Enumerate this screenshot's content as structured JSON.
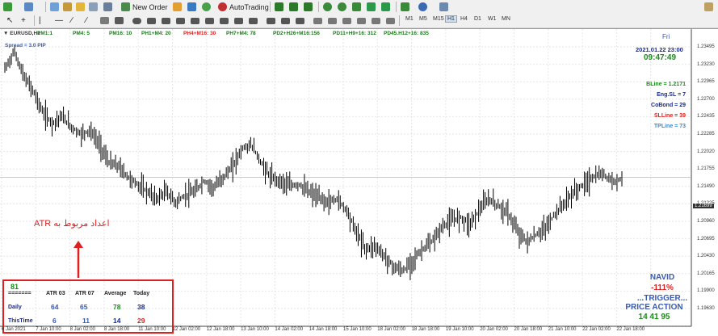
{
  "toolbar1": {
    "new_order_label": "New Order",
    "autotrading_label": "AutoTrading"
  },
  "timeframes": [
    "M1",
    "M5",
    "M15",
    "H1",
    "H4",
    "D1",
    "W1",
    "MN"
  ],
  "active_timeframe": "H1",
  "chart": {
    "symbol_label": "▼ EURUSD,H1",
    "spread_label": "Spread = 3.0  PIP",
    "header_items": [
      {
        "text": "PM1:1",
        "color": "#1a7a1a"
      },
      {
        "text": "PM4: 5",
        "color": "#1a7a1a"
      },
      {
        "text": "PM16: 10",
        "color": "#1a7a1a"
      },
      {
        "text": "PH1+M4: 20",
        "color": "#1a7a1a"
      },
      {
        "text": "PH4+M16: 30",
        "color": "#e02020"
      },
      {
        "text": "PH7+M4: 78",
        "color": "#1a7a1a"
      },
      {
        "text": "PD2+H26+M16:156",
        "color": "#1a7a1a"
      },
      {
        "text": "PD11+H9+16: 312",
        "color": "#1a7a1a"
      },
      {
        "text": "PD45.H12+16: 835",
        "color": "#1a7a1a"
      }
    ],
    "day": "Fri",
    "datetime": "2021.01.22 23:00",
    "countdown": "09:47:49",
    "indicators": [
      {
        "text": "BLine = 1.2171",
        "color": "#1a8a1a"
      },
      {
        "text": "Eng.SL = 7",
        "color": "#1a2a8a"
      },
      {
        "text": "CoBond = 29",
        "color": "#1a2a8a"
      },
      {
        "text": "SLLine = 39",
        "color": "#e02020"
      },
      {
        "text": "TPLine = 73",
        "color": "#3a8ad0"
      }
    ],
    "price_labels": [
      "1.23495",
      "1.23230",
      "1.22965",
      "1.22700",
      "1.22435",
      "1.22285",
      "1.22020",
      "1.21755",
      "1.21490",
      "1.21225",
      "1.20960",
      "1.20695",
      "1.20430",
      "1.20165",
      "1.19900",
      "1.19630"
    ],
    "current_price": "1.21699",
    "time_labels": [
      "6 Jan 2021",
      "7 Jan 10:00",
      "8 Jan 02:00",
      "8 Jan 18:00",
      "11 Jan 10:00",
      "12 Jan 02:00",
      "12 Jan 18:00",
      "13 Jan 10:00",
      "14 Jan 02:00",
      "14 Jan 18:00",
      "15 Jan 10:00",
      "18 Jan 02:00",
      "18 Jan 18:00",
      "19 Jan 10:00",
      "20 Jan 02:00",
      "20 Jan 18:00",
      "21 Jan 10:00",
      "22 Jan 02:00",
      "22 Jan 18:00"
    ],
    "annotation": "ATR اعداد مربوط به",
    "atr_table": {
      "count": "81",
      "divider": "=======",
      "headers": [
        "ATR 03",
        "ATR 07",
        "Average",
        "Today"
      ],
      "rows": [
        {
          "label": "Daily",
          "values": [
            "64",
            "65",
            "78",
            "38"
          ]
        },
        {
          "label": "ThisTime",
          "values": [
            "6",
            "11",
            "14",
            "29"
          ]
        }
      ]
    },
    "navid": {
      "name": "NAVID",
      "percent": "-111%",
      "trigger": "...TRIGGER...",
      "price_action": "PRICE ACTION",
      "numbers": "14  41  95"
    }
  },
  "chart_data": {
    "type": "ohlc",
    "symbol": "EURUSD",
    "timeframe": "H1",
    "ylim": [
      1.1963,
      1.2376
    ],
    "close_path": [
      1.232,
      1.2345,
      1.231,
      1.229,
      1.226,
      1.2245,
      1.2255,
      1.224,
      1.223,
      1.2235,
      1.2215,
      1.219,
      1.2185,
      1.217,
      1.216,
      1.215,
      1.214,
      1.215,
      1.2135,
      1.2145,
      1.215,
      1.2165,
      1.2155,
      1.217,
      1.2185,
      1.221,
      1.2215,
      1.219,
      1.217,
      1.2165,
      1.2158,
      1.216,
      1.215,
      1.2142,
      1.2135,
      1.214,
      1.2125,
      1.2095,
      1.207,
      1.2075,
      1.206,
      1.2045,
      1.204,
      1.2055,
      1.207,
      1.208,
      1.21,
      1.211,
      1.2115,
      1.2105,
      1.2125,
      1.214,
      1.213,
      1.212,
      1.2095,
      1.208,
      1.209,
      1.21,
      1.212,
      1.2135,
      1.215,
      1.216,
      1.217,
      1.2175,
      1.2165,
      1.2168
    ]
  }
}
